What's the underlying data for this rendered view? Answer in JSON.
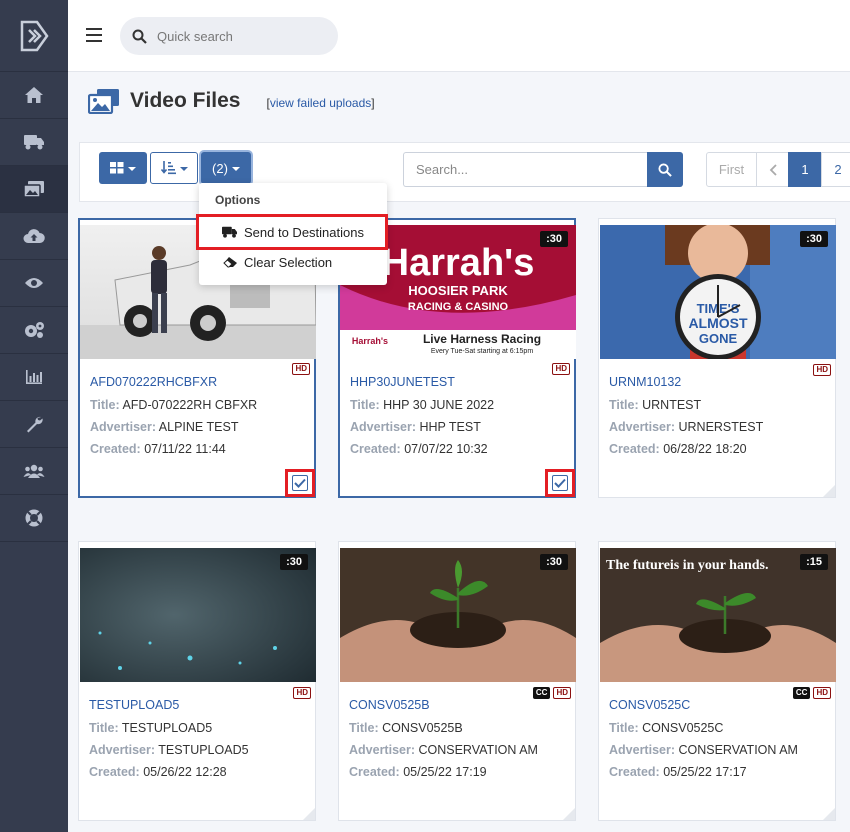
{
  "topbar": {
    "search_placeholder": "Quick search"
  },
  "sidebar": {
    "items": [
      {
        "icon": "home-icon"
      },
      {
        "icon": "truck-icon"
      },
      {
        "icon": "video-files-icon"
      },
      {
        "icon": "cloud-upload-icon"
      },
      {
        "icon": "eye-icon"
      },
      {
        "icon": "cogs-icon"
      },
      {
        "icon": "bar-chart-icon"
      },
      {
        "icon": "wrench-icon"
      },
      {
        "icon": "users-icon"
      },
      {
        "icon": "lifebuoy-icon"
      }
    ]
  },
  "header": {
    "title": "Video Files",
    "failed_link": "view failed uploads"
  },
  "toolbar": {
    "selection_label": "(2)",
    "search_placeholder": "Search...",
    "pager": {
      "first": "First",
      "pages": [
        "1",
        "2"
      ],
      "current": "1"
    }
  },
  "dropdown": {
    "header": "Options",
    "send_label": "Send to Destinations",
    "clear_label": "Clear Selection"
  },
  "labels": {
    "title": "Title:",
    "advertiser": "Advertiser:",
    "created": "Created:"
  },
  "cards": [
    {
      "id": "AFD070222RHCBFXR",
      "title": "AFD-070222RH CBFXR",
      "advertiser": "ALPINE TEST",
      "created": "07/11/22 11:44",
      "duration": "",
      "cc": false,
      "hd": true,
      "selected": true
    },
    {
      "id": "HHP30JUNETEST",
      "title": "HHP 30 JUNE 2022",
      "advertiser": "HHP TEST",
      "created": "07/07/22 10:32",
      "duration": ":30",
      "cc": false,
      "hd": true,
      "selected": true
    },
    {
      "id": "URNM10132",
      "title": "URNTEST",
      "advertiser": "URNERSTEST",
      "created": "06/28/22 18:20",
      "duration": ":30",
      "cc": false,
      "hd": true,
      "selected": false
    },
    {
      "id": "TESTUPLOAD5",
      "title": "TESTUPLOAD5",
      "advertiser": "TESTUPLOAD5",
      "created": "05/26/22 12:28",
      "duration": ":30",
      "cc": false,
      "hd": true,
      "selected": false
    },
    {
      "id": "CONSV0525B",
      "title": "CONSV0525B",
      "advertiser": "CONSERVATION AM",
      "created": "05/25/22 17:19",
      "duration": ":30",
      "cc": true,
      "hd": true,
      "selected": false
    },
    {
      "id": "CONSV0525C",
      "title": "CONSV0525C",
      "advertiser": "CONSERVATION AM",
      "created": "05/25/22 17:17",
      "duration": ":15",
      "cc": true,
      "hd": true,
      "selected": false
    }
  ],
  "thumb_text": {
    "harrahs": "Harrah's",
    "hoosier": "HOOSIER PARK",
    "racing": "RACING & CASINO",
    "live": "Live Harness Racing",
    "every": "Every Tue-Sat starting at 6:15pm",
    "times": "TIME'S",
    "almost": "ALMOST",
    "gone": "GONE",
    "future": "The futureis in your hands."
  },
  "colors": {
    "accent": "#3c68a6",
    "sidebar": "#353c4e",
    "highlight": "#e31e24",
    "hd": "#8b1010"
  }
}
